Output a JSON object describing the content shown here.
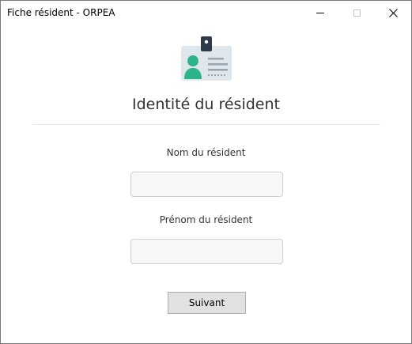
{
  "window": {
    "title": "Fiche résident - ORPEA",
    "controls": [
      "minimize-icon",
      "maximize-icon",
      "close-icon"
    ],
    "close_symbol": "✕"
  },
  "form": {
    "icon": "id-badge-icon",
    "heading": "Identité du résident",
    "nom_label": "Nom du résident",
    "nom_value": "",
    "prenom_label": "Prénom du résident",
    "prenom_value": "",
    "next_button_label": "Suivant"
  },
  "colors": {
    "badge_background": "#dfe6ec",
    "badge_clip": "#2f3a48",
    "person": "#2bb48a",
    "lines": "#9aa6b2",
    "button_background": "#e1e1e1"
  }
}
